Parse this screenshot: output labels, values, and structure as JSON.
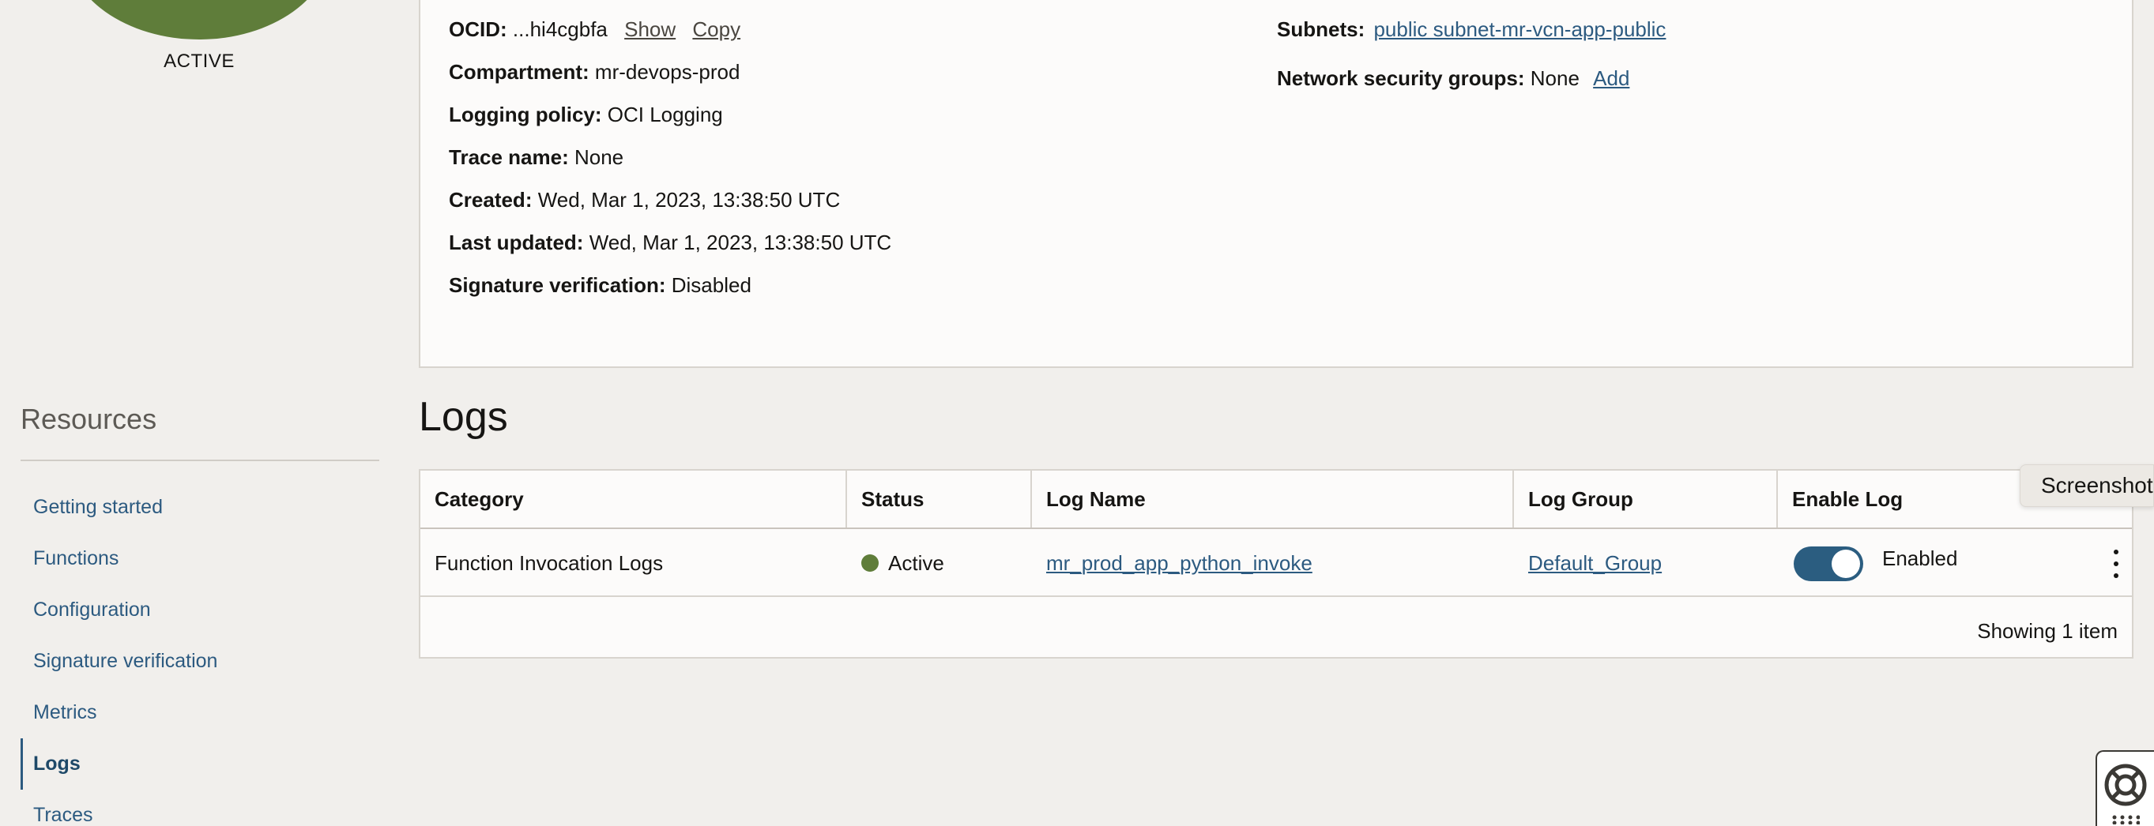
{
  "sidebar": {
    "status": "ACTIVE",
    "resources_title": "Resources",
    "items": [
      {
        "label": "Getting started"
      },
      {
        "label": "Functions"
      },
      {
        "label": "Configuration"
      },
      {
        "label": "Signature verification"
      },
      {
        "label": "Metrics"
      },
      {
        "label": "Logs",
        "active": true
      },
      {
        "label": "Traces"
      }
    ]
  },
  "details": {
    "ocid": {
      "key": "OCID:",
      "value": "...hi4cgbfa",
      "show": "Show",
      "copy": "Copy"
    },
    "compartment": {
      "key": "Compartment:",
      "value": "mr-devops-prod"
    },
    "logging_policy": {
      "key": "Logging policy:",
      "value": "OCI Logging"
    },
    "trace_name": {
      "key": "Trace name:",
      "value": "None"
    },
    "created": {
      "key": "Created:",
      "value": "Wed, Mar 1, 2023, 13:38:50 UTC"
    },
    "last_updated": {
      "key": "Last updated:",
      "value": "Wed, Mar 1, 2023, 13:38:50 UTC"
    },
    "signature_verification": {
      "key": "Signature verification:",
      "value": "Disabled"
    },
    "subnets": {
      "key": "Subnets:",
      "value": "public subnet-mr-vcn-app-public"
    },
    "nsg": {
      "key": "Network security groups:",
      "value": "None",
      "add": "Add"
    }
  },
  "logs": {
    "title": "Logs",
    "columns": [
      "Category",
      "Status",
      "Log Name",
      "Log Group",
      "Enable Log"
    ],
    "rows": [
      {
        "category": "Function Invocation Logs",
        "status": "Active",
        "log_name": "mr_prod_app_python_invoke",
        "log_group": "Default_Group",
        "enable_label": "Enabled",
        "enabled": true
      }
    ],
    "footer": "Showing 1 item"
  },
  "widgets": {
    "screenshot_label": "Screenshot"
  },
  "colors": {
    "accent": "#2c5a80",
    "active_status": "#5f7d3a",
    "toggle_on": "#2b5d80"
  },
  "icons": {
    "help": "lifebuoy-icon",
    "row_actions": "kebab-menu-icon"
  }
}
